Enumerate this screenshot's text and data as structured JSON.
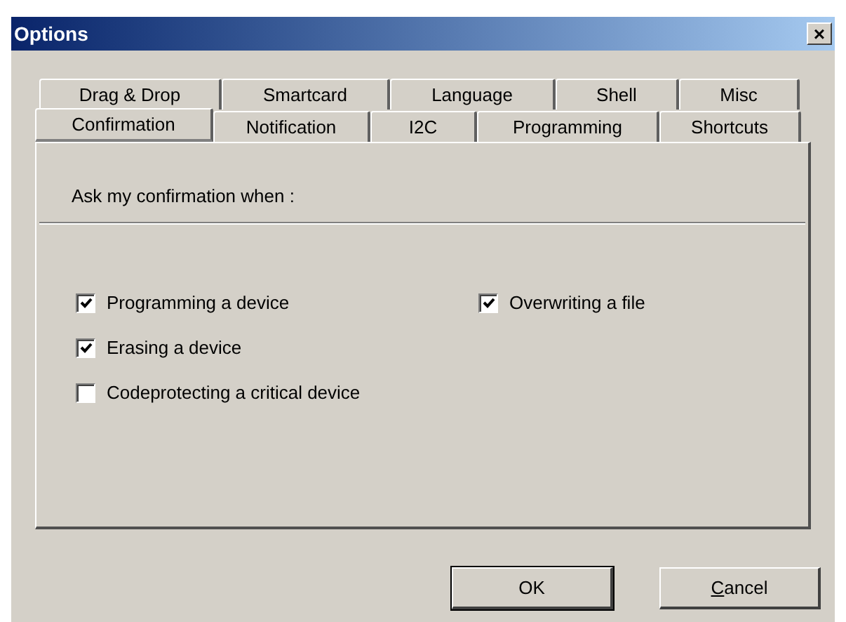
{
  "window": {
    "title": "Options",
    "close": "×"
  },
  "tab_rows": [
    [
      {
        "label": "Drag & Drop",
        "selected": false
      },
      {
        "label": "Smartcard",
        "selected": false
      },
      {
        "label": "Language",
        "selected": false
      },
      {
        "label": "Shell",
        "selected": false
      },
      {
        "label": "Misc",
        "selected": false
      }
    ],
    [
      {
        "label": "Confirmation",
        "selected": true
      },
      {
        "label": "Notification",
        "selected": false
      },
      {
        "label": "I2C",
        "selected": false
      },
      {
        "label": "Programming",
        "selected": false
      },
      {
        "label": "Shortcuts",
        "selected": false
      }
    ]
  ],
  "group": {
    "title": "Ask my confirmation when :"
  },
  "checkboxes_left": [
    {
      "label": "Programming a device",
      "checked": true
    },
    {
      "label": "Erasing a device",
      "checked": true
    },
    {
      "label": "Codeprotecting a critical device",
      "checked": false
    }
  ],
  "checkboxes_right": [
    {
      "label": "Overwriting a file",
      "checked": true
    }
  ],
  "buttons": [
    {
      "label": "OK",
      "default": true
    },
    {
      "label": "Cancel",
      "default": false
    }
  ]
}
